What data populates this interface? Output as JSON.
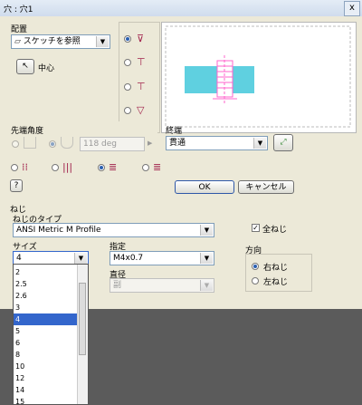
{
  "window": {
    "title": "穴 : 穴1",
    "close": "x"
  },
  "placement": {
    "heading": "配置",
    "combo_value": "スケッチを参照",
    "center_label": "中心"
  },
  "drill_point": {
    "heading": "先端角度",
    "angle_value": "118 deg"
  },
  "termination": {
    "heading": "終端",
    "value": "貫通"
  },
  "buttons": {
    "ok": "OK",
    "cancel": "キャンセル",
    "help": "?"
  },
  "thread": {
    "heading": "ねじ",
    "type_label": "ねじのタイプ",
    "type_value": "ANSI Metric M Profile",
    "full_thread_label": "全ねじ",
    "size_label": "サイズ",
    "size_value": "4",
    "designation_label": "指定",
    "designation_value": "M4x0.7",
    "diameter_label": "直径",
    "diameter_value": "副",
    "direction_label": "方向",
    "right_hand": "右ねじ",
    "left_hand": "左ねじ"
  },
  "size_dropdown": {
    "options": [
      "2",
      "2.5",
      "2.6",
      "3",
      "4",
      "5",
      "6",
      "8",
      "10",
      "12",
      "14",
      "15"
    ],
    "selected": "4"
  },
  "colors": {
    "accent": "#3366cc",
    "preview": "#ff66cc",
    "preview_fill": "#5fd0e0"
  }
}
